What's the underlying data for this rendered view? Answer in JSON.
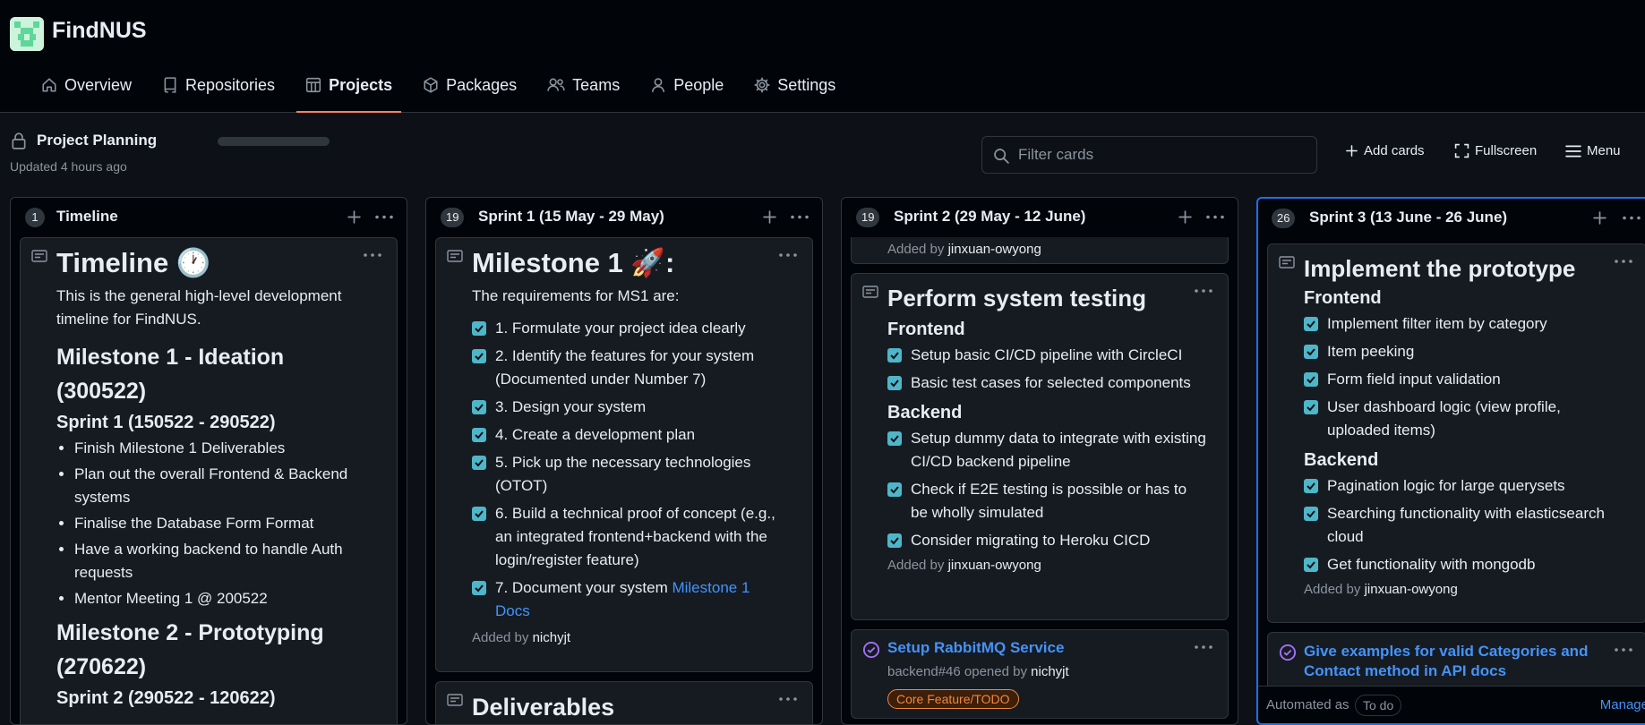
{
  "org": {
    "name": "FindNUS"
  },
  "nav": [
    {
      "label": "Overview",
      "icon": "home-icon"
    },
    {
      "label": "Repositories",
      "icon": "repo-icon"
    },
    {
      "label": "Projects",
      "icon": "project-icon",
      "active": true
    },
    {
      "label": "Packages",
      "icon": "package-icon"
    },
    {
      "label": "Teams",
      "icon": "people-icon"
    },
    {
      "label": "People",
      "icon": "person-icon"
    },
    {
      "label": "Settings",
      "icon": "gear-icon"
    }
  ],
  "project": {
    "title": "Project Planning",
    "updated": "Updated 4 hours ago"
  },
  "toolbar": {
    "filter_placeholder": "Filter cards",
    "add_cards": "Add cards",
    "fullscreen": "Fullscreen",
    "menu": "Menu"
  },
  "columns": [
    {
      "count": "1",
      "title": "Timeline",
      "card": {
        "heading": "Timeline 🕐",
        "intro": "This is the general high-level development timeline for FindNUS.",
        "m1_title": "Milestone 1 - Ideation (300522)",
        "s1_title": "Sprint 1 (150522 - 290522)",
        "s1_items": [
          "Finish Milestone 1 Deliverables",
          "Plan out the overall Frontend & Backend systems",
          "Finalise the Database Form Format",
          "Have a working backend to handle Auth requests",
          "Mentor Meeting 1 @ 200522"
        ],
        "m2_title": "Milestone 2 - Prototyping (270622)",
        "s2_title": "Sprint 2 (290522 - 120622)"
      }
    },
    {
      "count": "19",
      "title": "Sprint 1 (15 May - 29 May)",
      "card": {
        "heading": "Milestone 1 🚀:",
        "intro": "The requirements for MS1 are:",
        "items": [
          "1. Formulate your project idea clearly",
          "2. Identify the features for your system (Documented under Number 7)",
          "3. Design your system",
          "4. Create a development plan",
          "5. Pick up the necessary technologies (OTOT)",
          "6. Build a technical proof of concept (e.g., an integrated frontend+backend with the login/register feature)"
        ],
        "last_item": "7. Document your system ",
        "last_link": "Milestone 1 Docs",
        "added_prefix": "Added by ",
        "added_user": "nichyjt"
      },
      "next_heading": "Deliverables"
    },
    {
      "count": "19",
      "title": "Sprint 2 (29 May - 12 June)",
      "prev_added_prefix": "Added by ",
      "prev_added_user": "jinxuan-owyong",
      "card": {
        "heading": "Perform system testing",
        "frontend": "Frontend",
        "fe_items": [
          "Setup basic CI/CD pipeline with CircleCI",
          "Basic test cases for selected components"
        ],
        "backend": "Backend",
        "be_items": [
          "Setup dummy data to integrate with existing CI/CD backend pipeline",
          "Check if E2E testing is possible or has to be wholly simulated",
          "Consider migrating to Heroku CICD"
        ],
        "added_prefix": "Added by ",
        "added_user": "jinxuan-owyong"
      },
      "issue": {
        "title": "Setup RabbitMQ Service",
        "meta_prefix": "backend#46 opened by ",
        "meta_user": "nichyjt",
        "label": "Core Feature/TODO"
      }
    },
    {
      "count": "26",
      "title": "Sprint 3 (13 June - 26 June)",
      "card": {
        "heading": "Implement the prototype",
        "frontend": "Frontend",
        "fe_items": [
          "Implement filter item by category",
          "Item peeking",
          "Form field input validation",
          "User dashboard logic (view profile, uploaded items)"
        ],
        "backend": "Backend",
        "be_items": [
          "Pagination logic for large querysets",
          "Searching functionality with elasticsearch cloud",
          "Get functionality with mongodb"
        ],
        "added_prefix": "Added by ",
        "added_user": "jinxuan-owyong"
      },
      "issue": {
        "title": "Give examples for valid Categories and Contact method in API docs"
      },
      "footer": {
        "automated": "Automated as",
        "state": "To do",
        "manage": "Manage"
      }
    }
  ],
  "colors": {
    "accent": "#f78166",
    "link": "#4493f8",
    "check": "#4fb6c9",
    "label": "#f0883e",
    "focus": "#1f6feb"
  }
}
